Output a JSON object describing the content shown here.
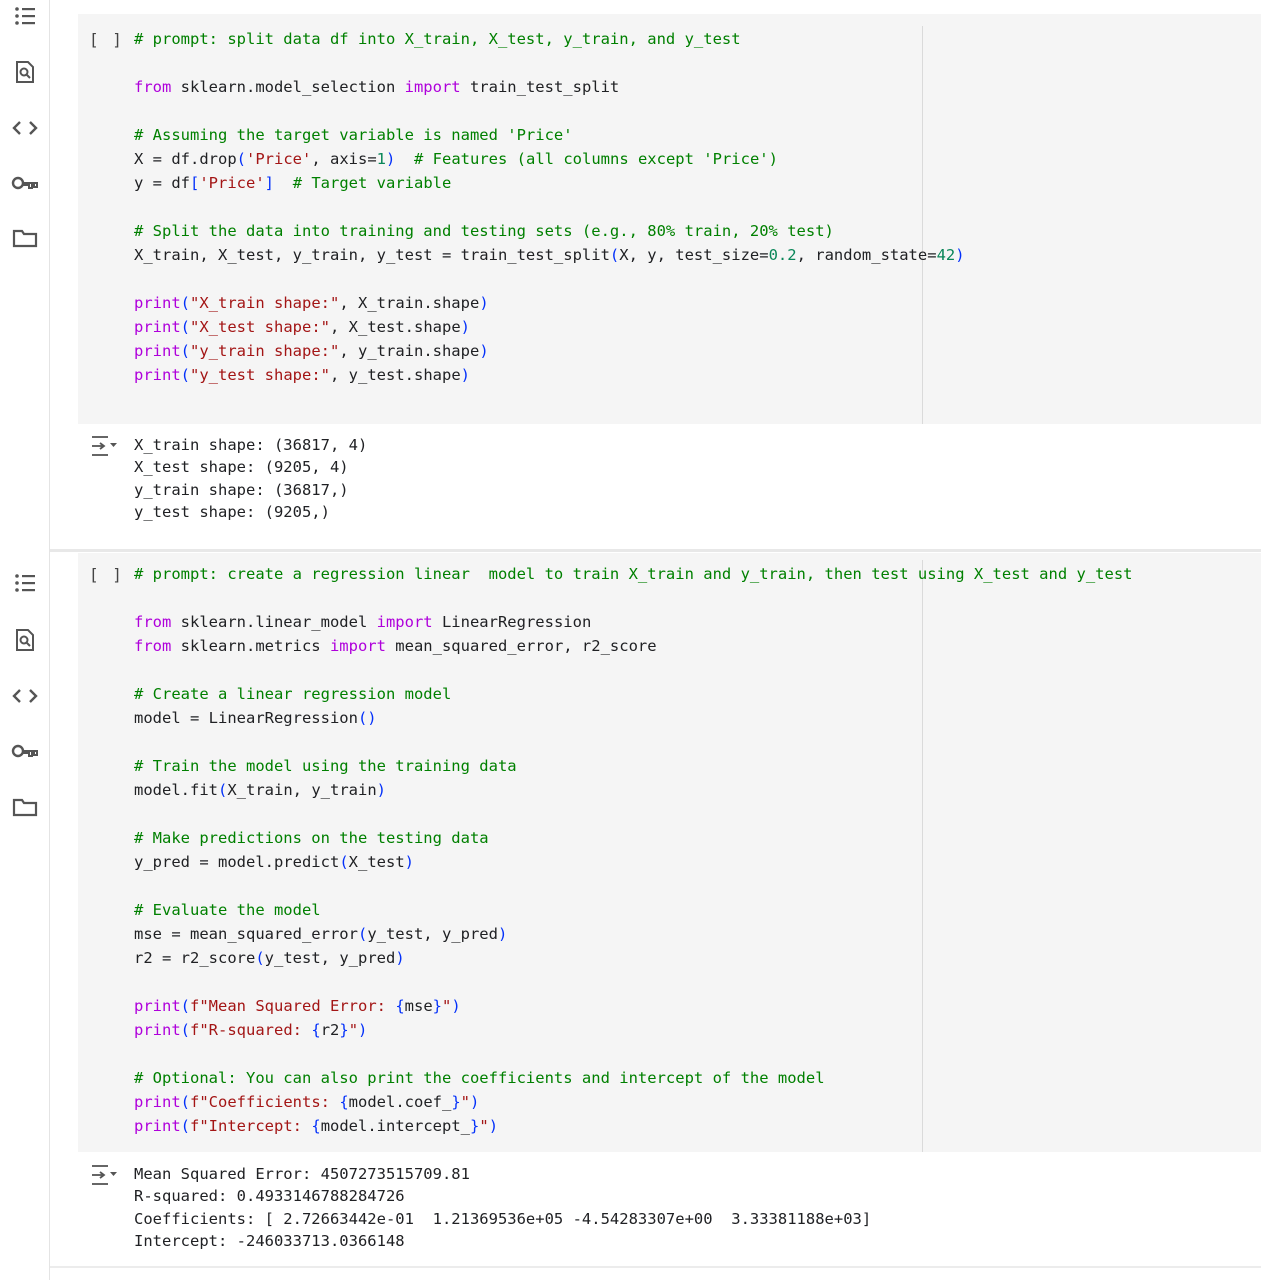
{
  "cells": [
    {
      "run_indicator": "[ ]",
      "code_lines": [
        [
          {
            "t": "# prompt: split data df into X_train, X_test, y_train, and y_test",
            "c": "cm"
          }
        ],
        [],
        [
          {
            "t": "from",
            "c": "kw"
          },
          {
            "t": " sklearn.model_selection "
          },
          {
            "t": "import",
            "c": "kw"
          },
          {
            "t": " train_test_split"
          }
        ],
        [],
        [
          {
            "t": "# Assuming the target variable is named 'Price'",
            "c": "cm"
          }
        ],
        [
          {
            "t": "X = df.drop"
          },
          {
            "t": "(",
            "c": "par"
          },
          {
            "t": "'Price'",
            "c": "str"
          },
          {
            "t": ", axis="
          },
          {
            "t": "1",
            "c": "num"
          },
          {
            "t": ")",
            "c": "par"
          },
          {
            "t": "  "
          },
          {
            "t": "# Features (all columns except 'Price')",
            "c": "cm"
          }
        ],
        [
          {
            "t": "y = df"
          },
          {
            "t": "[",
            "c": "par"
          },
          {
            "t": "'Price'",
            "c": "str"
          },
          {
            "t": "]",
            "c": "par"
          },
          {
            "t": "  "
          },
          {
            "t": "# Target variable",
            "c": "cm"
          }
        ],
        [],
        [
          {
            "t": "# Split the data into training and testing sets (e.g., 80% train, 20% test)",
            "c": "cm"
          }
        ],
        [
          {
            "t": "X_train, X_test, y_train, y_test = train_test_split"
          },
          {
            "t": "(",
            "c": "par"
          },
          {
            "t": "X, y, test_size="
          },
          {
            "t": "0.2",
            "c": "num"
          },
          {
            "t": ", random_state="
          },
          {
            "t": "42",
            "c": "num"
          },
          {
            "t": ")",
            "c": "par"
          }
        ],
        [],
        [
          {
            "t": "print",
            "c": "kw"
          },
          {
            "t": "(",
            "c": "par"
          },
          {
            "t": "\"X_train shape:\"",
            "c": "str"
          },
          {
            "t": ", X_train.shape"
          },
          {
            "t": ")",
            "c": "par"
          }
        ],
        [
          {
            "t": "print",
            "c": "kw"
          },
          {
            "t": "(",
            "c": "par"
          },
          {
            "t": "\"X_test shape:\"",
            "c": "str"
          },
          {
            "t": ", X_test.shape"
          },
          {
            "t": ")",
            "c": "par"
          }
        ],
        [
          {
            "t": "print",
            "c": "kw"
          },
          {
            "t": "(",
            "c": "par"
          },
          {
            "t": "\"y_train shape:\"",
            "c": "str"
          },
          {
            "t": ", y_train.shape"
          },
          {
            "t": ")",
            "c": "par"
          }
        ],
        [
          {
            "t": "print",
            "c": "kw"
          },
          {
            "t": "(",
            "c": "par"
          },
          {
            "t": "\"y_test shape:\"",
            "c": "str"
          },
          {
            "t": ", y_test.shape"
          },
          {
            "t": ")",
            "c": "par"
          }
        ]
      ],
      "output_lines": [
        "X_train shape: (36817, 4)",
        "X_test shape: (9205, 4)",
        "y_train shape: (36817,)",
        "y_test shape: (9205,)"
      ]
    },
    {
      "run_indicator": "[ ]",
      "code_lines": [
        [
          {
            "t": "# prompt: create a regression linear  model to train X_train and y_train, then test using X_test and y_test",
            "c": "cm"
          }
        ],
        [],
        [
          {
            "t": "from",
            "c": "kw"
          },
          {
            "t": " sklearn.linear_model "
          },
          {
            "t": "import",
            "c": "kw"
          },
          {
            "t": " LinearRegression"
          }
        ],
        [
          {
            "t": "from",
            "c": "kw"
          },
          {
            "t": " sklearn.metrics "
          },
          {
            "t": "import",
            "c": "kw"
          },
          {
            "t": " mean_squared_error, r2_score"
          }
        ],
        [],
        [
          {
            "t": "# Create a linear regression model",
            "c": "cm"
          }
        ],
        [
          {
            "t": "model = LinearRegression"
          },
          {
            "t": "()",
            "c": "par"
          }
        ],
        [],
        [
          {
            "t": "# Train the model using the training data",
            "c": "cm"
          }
        ],
        [
          {
            "t": "model.fit"
          },
          {
            "t": "(",
            "c": "par"
          },
          {
            "t": "X_train, y_train"
          },
          {
            "t": ")",
            "c": "par"
          }
        ],
        [],
        [
          {
            "t": "# Make predictions on the testing data",
            "c": "cm"
          }
        ],
        [
          {
            "t": "y_pred = model.predict"
          },
          {
            "t": "(",
            "c": "par"
          },
          {
            "t": "X_test"
          },
          {
            "t": ")",
            "c": "par"
          }
        ],
        [],
        [
          {
            "t": "# Evaluate the model",
            "c": "cm"
          }
        ],
        [
          {
            "t": "mse = mean_squared_error"
          },
          {
            "t": "(",
            "c": "par"
          },
          {
            "t": "y_test, y_pred"
          },
          {
            "t": ")",
            "c": "par"
          }
        ],
        [
          {
            "t": "r2 = r2_score"
          },
          {
            "t": "(",
            "c": "par"
          },
          {
            "t": "y_test, y_pred"
          },
          {
            "t": ")",
            "c": "par"
          }
        ],
        [],
        [
          {
            "t": "print",
            "c": "kw"
          },
          {
            "t": "(",
            "c": "par"
          },
          {
            "t": "f\"Mean Squared Error: ",
            "c": "str"
          },
          {
            "t": "{",
            "c": "par"
          },
          {
            "t": "mse"
          },
          {
            "t": "}",
            "c": "par"
          },
          {
            "t": "\"",
            "c": "str"
          },
          {
            "t": ")",
            "c": "par"
          }
        ],
        [
          {
            "t": "print",
            "c": "kw"
          },
          {
            "t": "(",
            "c": "par"
          },
          {
            "t": "f\"R-squared: ",
            "c": "str"
          },
          {
            "t": "{",
            "c": "par"
          },
          {
            "t": "r2"
          },
          {
            "t": "}",
            "c": "par"
          },
          {
            "t": "\"",
            "c": "str"
          },
          {
            "t": ")",
            "c": "par"
          }
        ],
        [],
        [
          {
            "t": "# Optional: You can also print the coefficients and intercept of the model",
            "c": "cm"
          }
        ],
        [
          {
            "t": "print",
            "c": "kw"
          },
          {
            "t": "(",
            "c": "par"
          },
          {
            "t": "f\"Coefficients: ",
            "c": "str"
          },
          {
            "t": "{",
            "c": "par"
          },
          {
            "t": "model.coef_"
          },
          {
            "t": "}",
            "c": "par"
          },
          {
            "t": "\"",
            "c": "str"
          },
          {
            "t": ")",
            "c": "par"
          }
        ],
        [
          {
            "t": "print",
            "c": "kw"
          },
          {
            "t": "(",
            "c": "par"
          },
          {
            "t": "f\"Intercept: ",
            "c": "str"
          },
          {
            "t": "{",
            "c": "par"
          },
          {
            "t": "model.intercept_"
          },
          {
            "t": "}",
            "c": "par"
          },
          {
            "t": "\"",
            "c": "str"
          },
          {
            "t": ")",
            "c": "par"
          }
        ]
      ],
      "output_lines": [
        "Mean Squared Error: 4507273515709.81",
        "R-squared: 0.4933146788284726",
        "Coefficients: [ 2.72663442e-01  1.21369536e+05 -4.54283307e+00  3.33381188e+03]",
        "Intercept: -246033713.0366148"
      ]
    }
  ],
  "sidebar_icons": [
    "table-of-contents-icon",
    "find-icon",
    "code-snippets-icon",
    "secrets-key-icon",
    "files-folder-icon"
  ],
  "colors": {
    "keyword": "#af00db",
    "string": "#a31515",
    "comment": "#008000",
    "number": "#098658",
    "bracket": "#0431fa"
  }
}
